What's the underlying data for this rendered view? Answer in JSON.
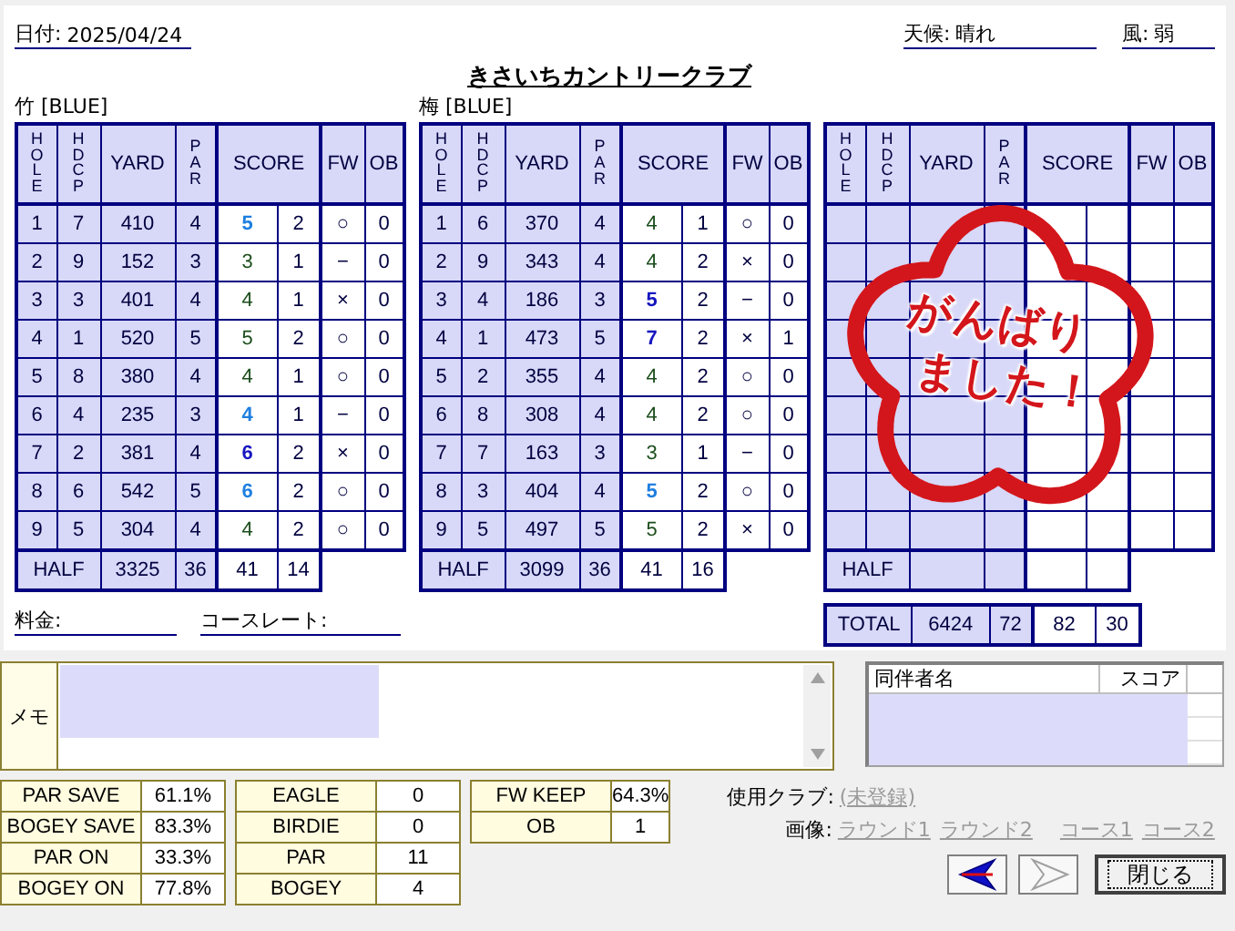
{
  "header": {
    "date": {
      "label": "日付:",
      "value": "2025/04/24"
    },
    "weather": {
      "label": "天候:",
      "value": "晴れ"
    },
    "wind": {
      "label": "風:",
      "value": "弱"
    },
    "title": "きさいちカントリークラブ"
  },
  "courses": [
    {
      "name": "竹 [BLUE]",
      "columns": [
        "HOLE",
        "HDCP",
        "YARD",
        "PAR",
        "SCORE",
        "FW",
        "OB"
      ],
      "holes": [
        {
          "hole": "1",
          "hdcp": "7",
          "yard": "410",
          "par": "4",
          "score": "5",
          "kind": "bogey",
          "putts": "2",
          "fw": "○",
          "ob": "0"
        },
        {
          "hole": "2",
          "hdcp": "9",
          "yard": "152",
          "par": "3",
          "score": "3",
          "kind": "par",
          "putts": "1",
          "fw": "−",
          "ob": "0"
        },
        {
          "hole": "3",
          "hdcp": "3",
          "yard": "401",
          "par": "4",
          "score": "4",
          "kind": "par",
          "putts": "1",
          "fw": "×",
          "ob": "0"
        },
        {
          "hole": "4",
          "hdcp": "1",
          "yard": "520",
          "par": "5",
          "score": "5",
          "kind": "par",
          "putts": "2",
          "fw": "○",
          "ob": "0"
        },
        {
          "hole": "5",
          "hdcp": "8",
          "yard": "380",
          "par": "4",
          "score": "4",
          "kind": "par",
          "putts": "1",
          "fw": "○",
          "ob": "0"
        },
        {
          "hole": "6",
          "hdcp": "4",
          "yard": "235",
          "par": "3",
          "score": "4",
          "kind": "bogey",
          "putts": "1",
          "fw": "−",
          "ob": "0"
        },
        {
          "hole": "7",
          "hdcp": "2",
          "yard": "381",
          "par": "4",
          "score": "6",
          "kind": "double",
          "putts": "2",
          "fw": "×",
          "ob": "0"
        },
        {
          "hole": "8",
          "hdcp": "6",
          "yard": "542",
          "par": "5",
          "score": "6",
          "kind": "bogey",
          "putts": "2",
          "fw": "○",
          "ob": "0"
        },
        {
          "hole": "9",
          "hdcp": "5",
          "yard": "304",
          "par": "4",
          "score": "4",
          "kind": "par",
          "putts": "2",
          "fw": "○",
          "ob": "0"
        }
      ],
      "half": {
        "label": "HALF",
        "yard": "3325",
        "par": "36",
        "score": "41",
        "putts": "14"
      }
    },
    {
      "name": "梅 [BLUE]",
      "columns": [
        "HOLE",
        "HDCP",
        "YARD",
        "PAR",
        "SCORE",
        "FW",
        "OB"
      ],
      "holes": [
        {
          "hole": "1",
          "hdcp": "6",
          "yard": "370",
          "par": "4",
          "score": "4",
          "kind": "par",
          "putts": "1",
          "fw": "○",
          "ob": "0"
        },
        {
          "hole": "2",
          "hdcp": "9",
          "yard": "343",
          "par": "4",
          "score": "4",
          "kind": "par",
          "putts": "2",
          "fw": "×",
          "ob": "0"
        },
        {
          "hole": "3",
          "hdcp": "4",
          "yard": "186",
          "par": "3",
          "score": "5",
          "kind": "double",
          "putts": "2",
          "fw": "−",
          "ob": "0"
        },
        {
          "hole": "4",
          "hdcp": "1",
          "yard": "473",
          "par": "5",
          "score": "7",
          "kind": "double",
          "putts": "2",
          "fw": "×",
          "ob": "1"
        },
        {
          "hole": "5",
          "hdcp": "2",
          "yard": "355",
          "par": "4",
          "score": "4",
          "kind": "par",
          "putts": "2",
          "fw": "○",
          "ob": "0"
        },
        {
          "hole": "6",
          "hdcp": "8",
          "yard": "308",
          "par": "4",
          "score": "4",
          "kind": "par",
          "putts": "2",
          "fw": "○",
          "ob": "0"
        },
        {
          "hole": "7",
          "hdcp": "7",
          "yard": "163",
          "par": "3",
          "score": "3",
          "kind": "par",
          "putts": "1",
          "fw": "−",
          "ob": "0"
        },
        {
          "hole": "8",
          "hdcp": "3",
          "yard": "404",
          "par": "4",
          "score": "5",
          "kind": "bogey",
          "putts": "2",
          "fw": "○",
          "ob": "0"
        },
        {
          "hole": "9",
          "hdcp": "5",
          "yard": "497",
          "par": "5",
          "score": "5",
          "kind": "par",
          "putts": "2",
          "fw": "×",
          "ob": "0"
        }
      ],
      "half": {
        "label": "HALF",
        "yard": "3099",
        "par": "36",
        "score": "41",
        "putts": "16"
      }
    },
    {
      "columns": [
        "HOLE",
        "HDCP",
        "YARD",
        "PAR",
        "SCORE",
        "FW",
        "OB"
      ],
      "half": {
        "label": "HALF"
      }
    }
  ],
  "total": {
    "label": "TOTAL",
    "yard": "6424",
    "par": "72",
    "score": "82",
    "putts": "30"
  },
  "stamp": {
    "lines": [
      "がんばり",
      "ました！"
    ]
  },
  "fees": {
    "fee_label": "料金:",
    "rate_label": "コースレート:"
  },
  "memo": {
    "label": "メモ"
  },
  "companions": {
    "columns": [
      "同伴者名",
      "スコア"
    ]
  },
  "stat_groups": [
    {
      "items": [
        {
          "label": "PAR SAVE",
          "value": "61.1%"
        },
        {
          "label": "BOGEY SAVE",
          "value": "83.3%"
        },
        {
          "label": "PAR ON",
          "value": "33.3%"
        },
        {
          "label": "BOGEY ON",
          "value": "77.8%"
        }
      ]
    },
    {
      "items": [
        {
          "label": "EAGLE",
          "value": "0"
        },
        {
          "label": "BIRDIE",
          "value": "0"
        },
        {
          "label": "PAR",
          "value": "11"
        },
        {
          "label": "BOGEY",
          "value": "4"
        }
      ]
    },
    {
      "items": [
        {
          "label": "FW KEEP",
          "value": "64.3%"
        },
        {
          "label": "OB",
          "value": "1"
        }
      ]
    }
  ],
  "clubs": {
    "label": "使用クラブ:",
    "link": "(未登録)"
  },
  "images": {
    "label": "画像:",
    "links": [
      "ラウンド1",
      "ラウンド2",
      "コース1",
      "コース2"
    ]
  },
  "buttons": [
    {
      "kind": "back",
      "disabled": false
    },
    {
      "kind": "forward",
      "disabled": true
    },
    {
      "kind": "close",
      "label": "閉じる",
      "disabled": false
    }
  ]
}
